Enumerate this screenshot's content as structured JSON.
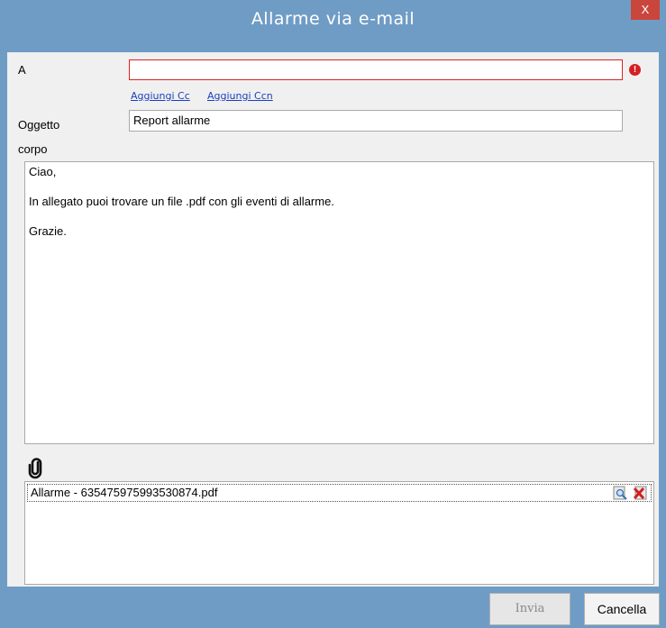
{
  "window": {
    "title": "Allarme via e-mail",
    "close_label": "X"
  },
  "form": {
    "to_label": "A",
    "to_value": "",
    "add_cc": "Aggiungi Cc",
    "add_ccn": "Aggiungi Ccn",
    "subject_label": "Oggetto",
    "subject_value": "Report allarme",
    "body_label": "corpo",
    "body_lines": [
      "Ciao,",
      "In allegato puoi trovare un file .pdf con gli eventi di allarme.",
      "Grazie."
    ]
  },
  "attachments": [
    {
      "filename": "Allarme - 635475975993530874.pdf"
    }
  ],
  "footer": {
    "send_label": "Invia",
    "cancel_label": "Cancella"
  },
  "colors": {
    "titlebar": "#6f9cc5",
    "close": "#c9463d",
    "error": "#e02020",
    "link": "#1a3fbf"
  },
  "icons": [
    "error-icon",
    "paperclip-icon",
    "preview-icon",
    "delete-icon"
  ]
}
